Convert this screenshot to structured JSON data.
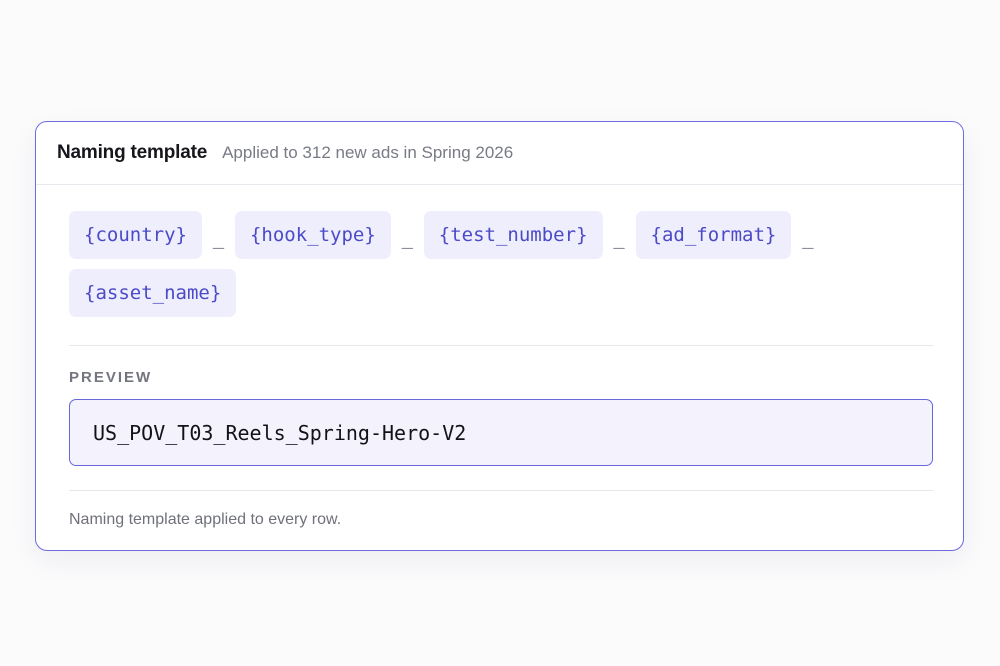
{
  "header": {
    "title": "Naming template",
    "subtitle": "Applied to 312 new ads in Spring 2026"
  },
  "tokens": [
    "{country}",
    "{hook_type}",
    "{test_number}",
    "{ad_format}",
    "{asset_name}"
  ],
  "separator": "_",
  "preview": {
    "label": "PREVIEW",
    "value": "US_POV_T03_Reels_Spring-Hero-V2"
  },
  "footnote": "Naming template applied to every row.",
  "colors": {
    "accent": "#6e6de0",
    "token_bg": "#efeefc",
    "token_text": "#4b4ac7",
    "preview_bg": "#f3f2fd"
  }
}
